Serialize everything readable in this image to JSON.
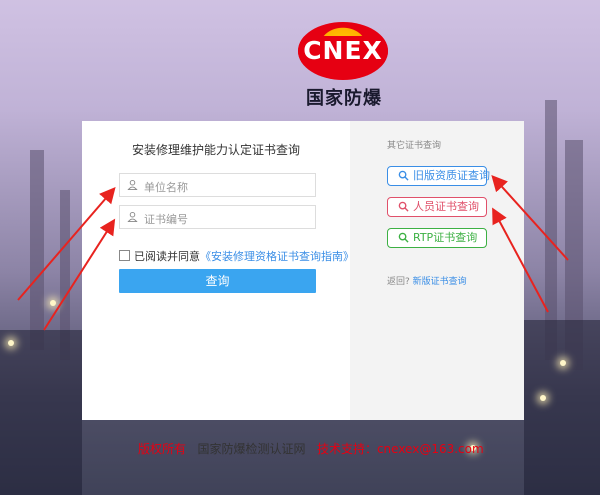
{
  "brand": {
    "logo_text": "CNEX",
    "name": "国家防爆"
  },
  "form": {
    "title": "安装修理维护能力认定证书查询",
    "unit_placeholder": "单位名称",
    "cert_placeholder": "证书编号",
    "agree_text": "已阅读并同意",
    "agree_link": "《安装修理资格证书查询指南》",
    "submit_label": "查询"
  },
  "sidebar": {
    "title": "其它证书查询",
    "buttons": [
      {
        "label": "旧版资质证查询",
        "color": "#3a8ee6"
      },
      {
        "label": "人员证书查询",
        "color": "#e0506a"
      },
      {
        "label": "RTP证书查询",
        "color": "#3cb043"
      }
    ],
    "back_text": "返回?",
    "back_link": "新版证书查询"
  },
  "footer": {
    "copyright": "版权所有",
    "site": "国家防爆检测认证网",
    "support": "技术支持：cnexex@163.com"
  },
  "colors": {
    "accent": "#3aa5f0",
    "brand_red": "#e60012",
    "arrow": "#e8231f"
  }
}
